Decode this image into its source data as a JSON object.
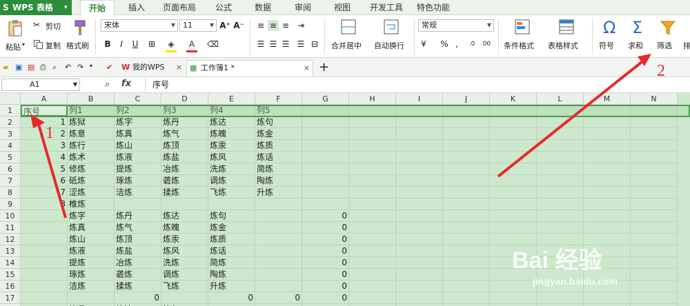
{
  "app": {
    "name": "WPS 表格"
  },
  "tabs": [
    "开始",
    "插入",
    "页面布局",
    "公式",
    "数据",
    "审阅",
    "视图",
    "开发工具",
    "特色功能"
  ],
  "ribbon": {
    "paste": "粘贴",
    "cut": "剪切",
    "copy": "复制",
    "format_painter": "格式刷",
    "font_name": "宋体",
    "font_size": "11",
    "merge_center": "合并居中",
    "wrap_text": "自动换行",
    "number_format": "常规",
    "cond_format": "条件格式",
    "table_style": "表格样式",
    "symbol": "符号",
    "sum": "求和",
    "filter": "筛选",
    "sort": "排",
    "percent": "%",
    "comma": ","
  },
  "doc_tabs": {
    "mywps": "我的WPS",
    "workbook": "工作簿1 *",
    "new_tab": "+"
  },
  "formula_bar": {
    "cell_ref": "A1",
    "fx": "fx",
    "content": "序号"
  },
  "grid": {
    "columns": [
      "A",
      "B",
      "C",
      "D",
      "E",
      "F",
      "G",
      "H",
      "I",
      "J",
      "K",
      "L",
      "M",
      "N"
    ],
    "row_numbers": [
      "1",
      "2",
      "3",
      "4",
      "5",
      "6",
      "7",
      "8",
      "9",
      "10",
      "11",
      "12",
      "13",
      "14",
      "15",
      "16",
      "17",
      "18"
    ],
    "rows": [
      [
        "序号",
        "列1",
        "列2",
        "列3",
        "列4",
        "列5"
      ],
      [
        "1",
        "炼狱",
        "炼字",
        "炼丹",
        "炼达",
        "炼句"
      ],
      [
        "2",
        "炼意",
        "炼真",
        "炼气",
        "炼魄",
        "炼金"
      ],
      [
        "3",
        "炼行",
        "炼山",
        "炼顶",
        "炼汞",
        "炼质"
      ],
      [
        "4",
        "炼术",
        "炼液",
        "炼盐",
        "炼风",
        "炼话"
      ],
      [
        "5",
        "修炼",
        "提炼",
        "冶炼",
        "洗炼",
        "简炼"
      ],
      [
        "6",
        "砥炼",
        "琢炼",
        "砻炼",
        "调炼",
        "陶炼"
      ],
      [
        "7",
        "涩炼",
        "洁炼",
        "揉炼",
        "飞炼",
        "升炼"
      ],
      [
        "8",
        "椎炼",
        "",
        "",
        "",
        "",
        ""
      ],
      [
        "",
        "炼字",
        "炼丹",
        "炼达",
        "炼句",
        "",
        "0"
      ],
      [
        "",
        "炼真",
        "炼气",
        "炼魄",
        "炼金",
        "",
        "0"
      ],
      [
        "",
        "炼山",
        "炼顶",
        "炼汞",
        "炼质",
        "",
        "0"
      ],
      [
        "",
        "炼液",
        "炼盐",
        "炼风",
        "炼话",
        "",
        "0"
      ],
      [
        "",
        "提炼",
        "冶炼",
        "洗炼",
        "简炼",
        "",
        "0"
      ],
      [
        "",
        "琢炼",
        "砻炼",
        "调炼",
        "陶炼",
        "",
        "0"
      ],
      [
        "",
        "洁炼",
        "揉炼",
        "飞炼",
        "升炼",
        "",
        "0"
      ],
      [
        "",
        "",
        "0",
        "",
        "0",
        "0",
        "0"
      ],
      [
        "",
        "炼丹",
        "炼达",
        "炼句",
        "",
        "",
        ""
      ]
    ]
  },
  "annotations": {
    "label1": "1",
    "label2": "2",
    "arrow_color": "#e52a2a"
  },
  "watermark": {
    "brand": "Bai 经验",
    "url": "jingyan.baidu.com"
  }
}
